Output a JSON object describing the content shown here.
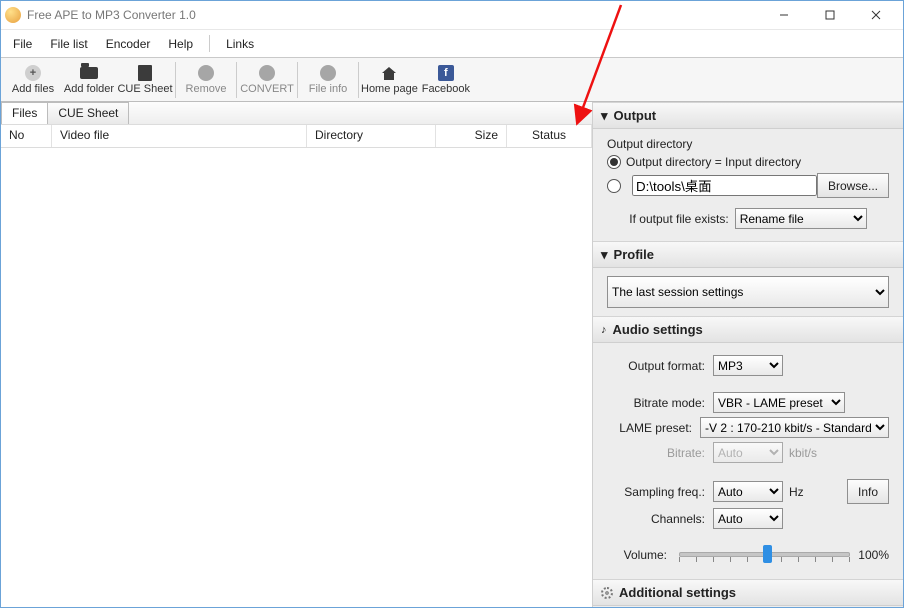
{
  "window": {
    "title": "Free APE to MP3 Converter 1.0"
  },
  "menu": [
    "File",
    "File list",
    "Encoder",
    "Help",
    "Links"
  ],
  "toolbar": [
    {
      "label": "Add files",
      "icon": "plus",
      "interact": true
    },
    {
      "label": "Add folder",
      "icon": "folder",
      "interact": true
    },
    {
      "label": "CUE Sheet",
      "icon": "doc",
      "interact": true
    },
    {
      "label": "Remove",
      "icon": "dot",
      "interact": false
    },
    {
      "label": "CONVERT",
      "icon": "dot",
      "interact": false
    },
    {
      "label": "File info",
      "icon": "dot",
      "interact": false
    },
    {
      "label": "Home page",
      "icon": "home",
      "interact": true
    },
    {
      "label": "Facebook",
      "icon": "fb",
      "interact": true
    }
  ],
  "left": {
    "tabs": [
      "Files",
      "CUE Sheet"
    ],
    "columns": [
      "No",
      "Video file",
      "Directory",
      "Size",
      "Status"
    ]
  },
  "output": {
    "header": "Output",
    "dir_label": "Output directory",
    "opt_same": "Output directory = Input directory",
    "path": "D:\\tools\\桌面",
    "browse": "Browse...",
    "exist_label": "If output file exists:",
    "exist_value": "Rename file"
  },
  "profile": {
    "header": "Profile",
    "value": "The last session settings"
  },
  "audio": {
    "header": "Audio settings",
    "format_label": "Output format:",
    "format_value": "MP3",
    "brmode_label": "Bitrate mode:",
    "brmode_value": "VBR - LAME preset",
    "lame_label": "LAME preset:",
    "lame_value": "-V 2 : 170-210 kbit/s - Standard",
    "bitrate_label": "Bitrate:",
    "bitrate_value": "Auto",
    "bitrate_unit": "kbit/s",
    "sf_label": "Sampling freq.:",
    "sf_value": "Auto",
    "sf_unit": "Hz",
    "ch_label": "Channels:",
    "ch_value": "Auto",
    "info": "Info",
    "vol_label": "Volume:",
    "vol_pct": "100%"
  },
  "additional": {
    "header": "Additional settings"
  }
}
